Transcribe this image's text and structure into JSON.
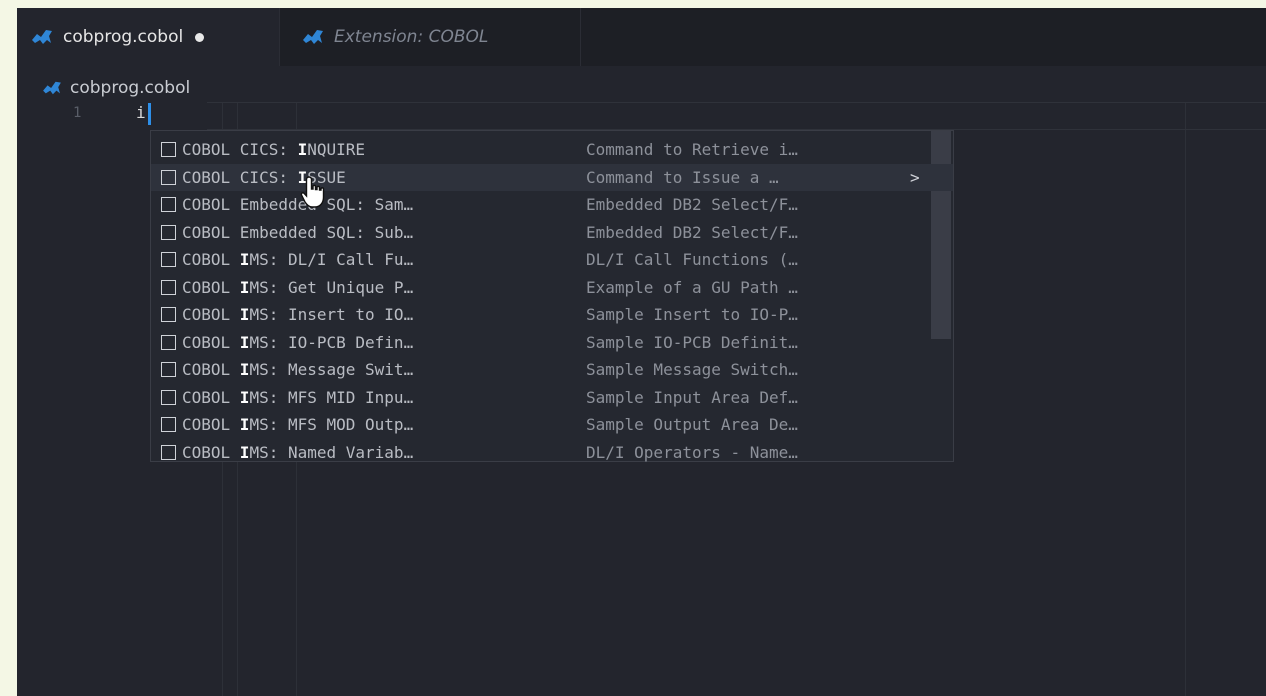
{
  "tabs": [
    {
      "label": "cobprog.cobol",
      "active": true,
      "dirty": true,
      "icon": "cobol-file-icon"
    },
    {
      "label": "Extension: COBOL",
      "active": false,
      "icon": "cobol-extension-icon"
    }
  ],
  "breadcrumb": {
    "label": "cobprog.cobol",
    "icon": "cobol-file-icon"
  },
  "editor": {
    "line_number": "1",
    "typed_text": "i"
  },
  "suggestions": [
    {
      "prefix": "COBOL CICS: ",
      "match": "I",
      "rest": "NQUIRE",
      "detail": "Command to Retrieve i…"
    },
    {
      "prefix": "COBOL CICS: ",
      "match": "I",
      "rest": "SSUE",
      "detail": "Command to Issue a …",
      "more": ">"
    },
    {
      "prefix": "COBOL Embedded SQL: Sam…",
      "match": "",
      "rest": "",
      "detail": "Embedded DB2 Select/F…"
    },
    {
      "prefix": "COBOL Embedded SQL: Sub…",
      "match": "",
      "rest": "",
      "detail": "Embedded DB2 Select/F…"
    },
    {
      "prefix": "COBOL ",
      "match": "I",
      "rest": "MS: DL/I Call Fu…",
      "detail": "DL/I Call Functions (…"
    },
    {
      "prefix": "COBOL ",
      "match": "I",
      "rest": "MS: Get Unique P…",
      "detail": "Example of a GU Path …"
    },
    {
      "prefix": "COBOL ",
      "match": "I",
      "rest": "MS: Insert to IO…",
      "detail": "Sample Insert to IO-P…"
    },
    {
      "prefix": "COBOL ",
      "match": "I",
      "rest": "MS: IO-PCB Defin…",
      "detail": "Sample IO-PCB Definit…"
    },
    {
      "prefix": "COBOL ",
      "match": "I",
      "rest": "MS: Message Swit…",
      "detail": "Sample Message Switch…"
    },
    {
      "prefix": "COBOL ",
      "match": "I",
      "rest": "MS: MFS MID Inpu…",
      "detail": "Sample Input Area Def…"
    },
    {
      "prefix": "COBOL ",
      "match": "I",
      "rest": "MS: MFS MOD Outp…",
      "detail": "Sample Output Area De…"
    },
    {
      "prefix": "COBOL ",
      "match": "I",
      "rest": "MS: Named Variab…",
      "detail": "DL/I Operators - Name…"
    }
  ],
  "colors": {
    "accent": "#2e8fe8",
    "background": "#23252d",
    "tabbar": "#1d1f25"
  }
}
